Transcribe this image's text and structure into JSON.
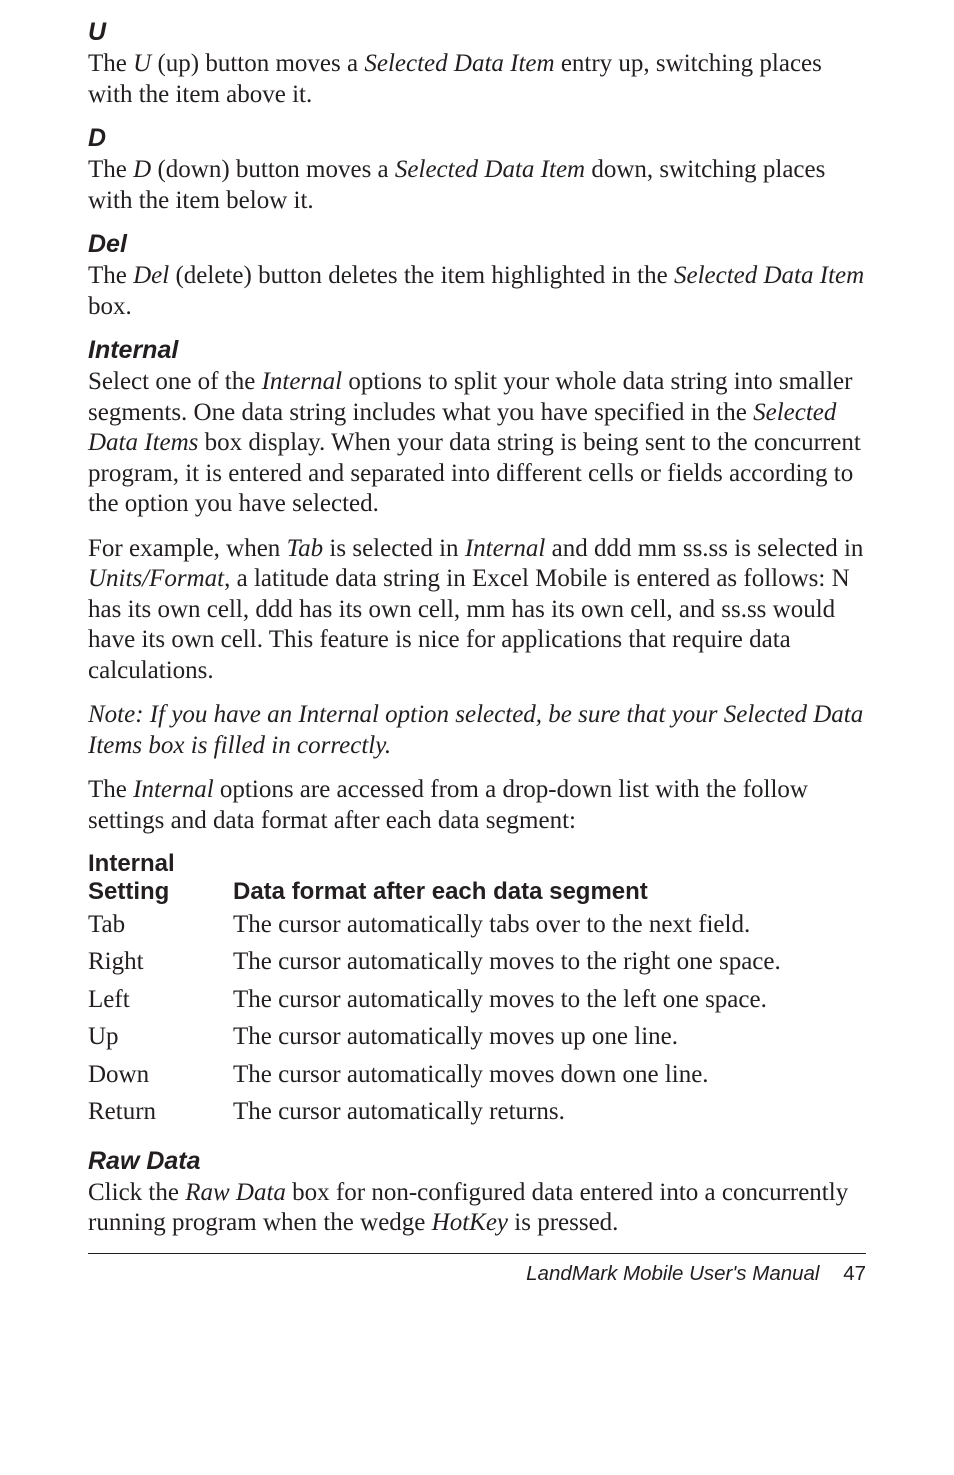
{
  "sections": {
    "u": {
      "heading": "U",
      "body": "The U (up) button moves a Selected Data Item entry up, switching places with the item above it."
    },
    "d": {
      "heading": "D",
      "body": "The D (down) button moves a Selected Data Item down, switching places with the item below it."
    },
    "del": {
      "heading": "Del",
      "body": "The Del (delete) button deletes the item highlighted in the Selected Data Item box."
    },
    "internal": {
      "heading": "Internal",
      "intro": "Select one of the Internal options to split your whole data string into smaller segments. One data string includes what you have specified in the Selected Data Items box display. When your data string is being sent to the concurrent program, it is entered and separated into different cells or fields according to the option you have selected.",
      "example": "For example, when Tab is selected in Internal and ddd mm ss.ss is selected in Units/Format, a latitude data string in Excel Mobile is entered as follows: N has its own cell, ddd has its own cell, mm has its own cell, and ss.ss would have its own cell. This feature is nice for applications that require data calculations.",
      "note": "Note: If you have an Internal option selected, be sure that your Selected Data Items box is filled in correctly.",
      "lead_out": "The Internal options are accessed from a drop-down list with the follow settings and data format after each data segment:"
    },
    "rawdata": {
      "heading": "Raw Data",
      "body": "Click the Raw Data box for non-configured data entered into a concurrently running program when the wedge HotKey is pressed."
    }
  },
  "table": {
    "header_col1_line1": "Internal",
    "header_col1_line2": "Setting",
    "header_col2": "Data format after each data segment",
    "rows": [
      {
        "key": "Tab",
        "val": "The cursor automatically tabs over to the next field."
      },
      {
        "key": "Right",
        "val": "The cursor automatically moves to the right one space."
      },
      {
        "key": "Left",
        "val": "The cursor automatically moves to the left one space."
      },
      {
        "key": "Up",
        "val": "The cursor automatically moves up one line."
      },
      {
        "key": "Down",
        "val": "The cursor automatically moves down one line."
      },
      {
        "key": "Return",
        "val": "The cursor automatically returns."
      }
    ]
  },
  "footer": {
    "title": "LandMark Mobile User's Manual",
    "page_number": "47"
  }
}
